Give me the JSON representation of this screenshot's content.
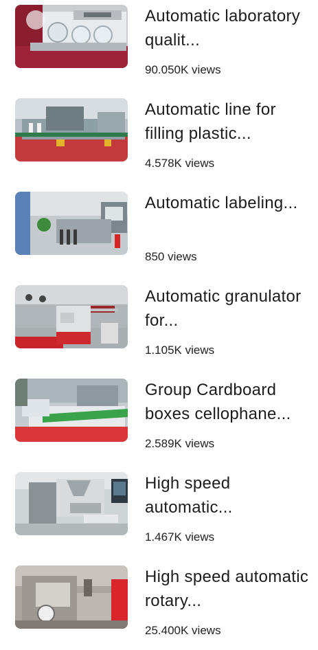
{
  "items": [
    {
      "title": "Automatic laboratory qualit...",
      "views": "90.050K views"
    },
    {
      "title": "Automatic line for filling plastic...",
      "views": "4.578K views"
    },
    {
      "title": "Automatic labeling...",
      "views": "850 views"
    },
    {
      "title": "Automatic granulator for...",
      "views": "1.105K views"
    },
    {
      "title": "Group Cardboard boxes cellophane...",
      "views": "2.589K views"
    },
    {
      "title": "High speed automatic...",
      "views": "1.467K views"
    },
    {
      "title": "High speed automatic rotary...",
      "views": "25.400K views"
    }
  ],
  "colors": {
    "title": "#1c1c1c",
    "views": "#222222",
    "accent_red": "#d81f2a"
  }
}
